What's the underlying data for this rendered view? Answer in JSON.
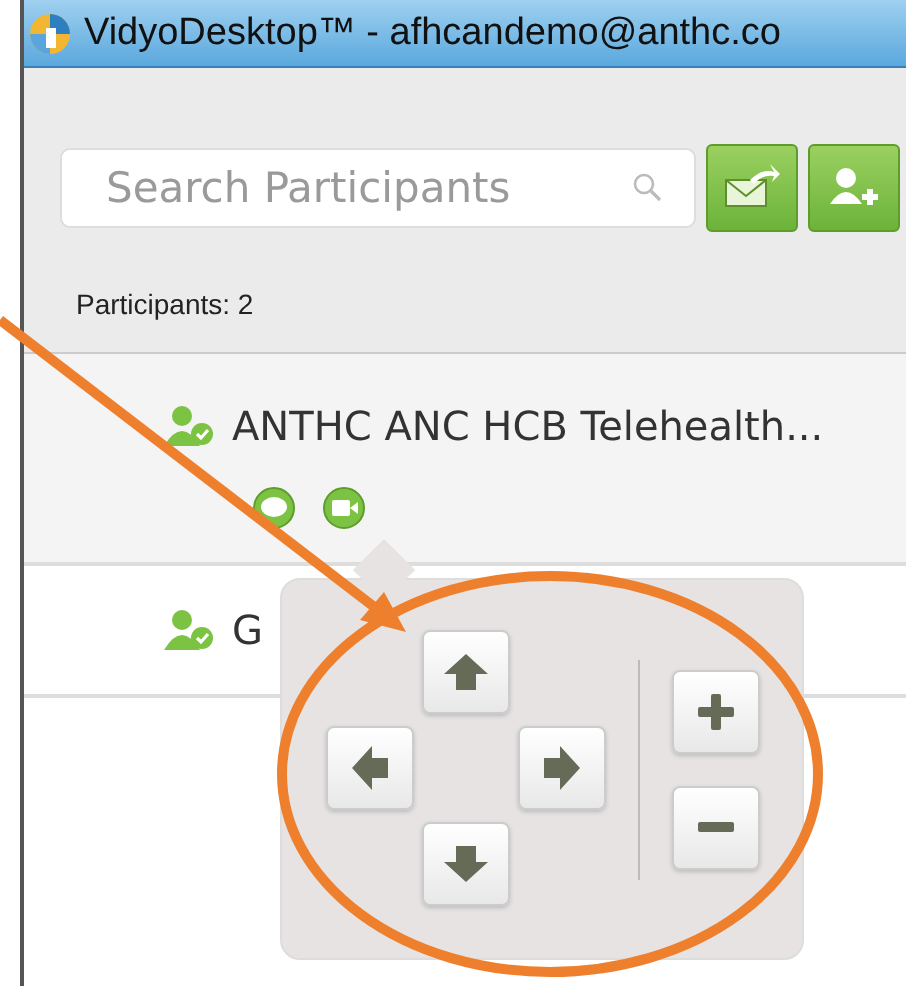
{
  "window": {
    "title": "VidyoDesktop™ - afhcandemo@anthc.co"
  },
  "search": {
    "placeholder": "Search Participants"
  },
  "participants_label": "Participants: 2",
  "participants": [
    {
      "name": "ANTHC ANC HCB Telehealth...",
      "actions": true
    },
    {
      "name": "G",
      "actions": false
    }
  ]
}
